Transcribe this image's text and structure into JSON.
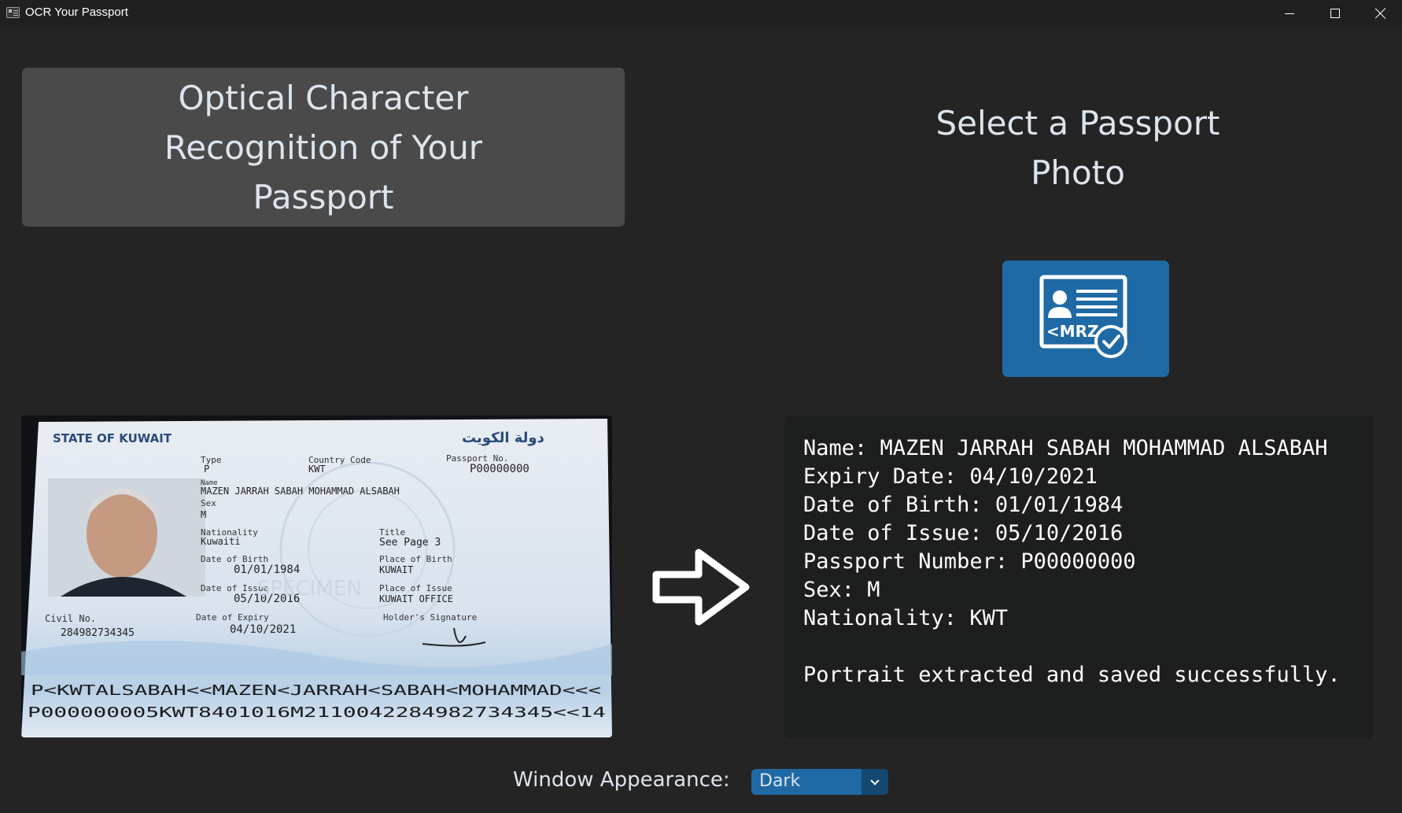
{
  "window": {
    "title": "OCR Your Passport"
  },
  "heading": {
    "text": "Optical Character Recognition of Your Passport"
  },
  "select": {
    "title": "Select a Passport Photo",
    "button_icon": "mrz-passport-icon",
    "button_icon_text": "<MRZ<<"
  },
  "passport": {
    "country_en": "STATE OF KUWAIT",
    "country_ar": "دولة الكويت",
    "type_label": "Type",
    "type_value": "P",
    "country_code_label": "Country Code",
    "country_code_value": "KWT",
    "passport_no_label": "Passport No.",
    "passport_no_value": "P00000000",
    "name_label": "Name",
    "name_value": "MAZEN JARRAH SABAH MOHAMMAD ALSABAH",
    "sex_label": "Sex",
    "sex_value": "M",
    "nationality_label": "Nationality",
    "nationality_value": "Kuwaiti",
    "title_label": "Title",
    "title_value": "See Page 3",
    "dob_label": "Date of Birth",
    "dob_value": "01/01/1984",
    "pob_label": "Place of Birth",
    "pob_value": "KUWAIT",
    "doi_label": "Date of Issue",
    "doi_value": "05/10/2016",
    "poi_label": "Place of Issue",
    "poi_value": "KUWAIT OFFICE",
    "civil_label": "Civil No.",
    "civil_value": "284982734345",
    "doe_label": "Date of Expiry",
    "doe_value": "04/10/2021",
    "signature_label": "Holder's Signature",
    "specimen": "SPECIMEN",
    "mrz_line1": "P<KWTALSABAH<<MAZEN<JARRAH<SABAH<MOHAMMAD<<<",
    "mrz_line2": "P000000005KWT8401016M2110042284982734345<<14"
  },
  "result": {
    "name": "Name: MAZEN JARRAH SABAH MOHAMMAD ALSABAH",
    "expiry": "Expiry Date: 04/10/2021",
    "dob": "Date of Birth: 01/01/1984",
    "issue": "Date of Issue: 05/10/2016",
    "passport_number": "Passport Number: P00000000",
    "sex": "Sex: M",
    "nationality": "Nationality: KWT",
    "status": "Portrait extracted and saved successfully."
  },
  "appearance": {
    "label": "Window Appearance:",
    "value": "Dark"
  },
  "colors": {
    "background": "#242424",
    "accent": "#1f6aa5",
    "accent_dark": "#144870",
    "card": "#4a4a4a",
    "textbox": "#1d1e1e"
  }
}
